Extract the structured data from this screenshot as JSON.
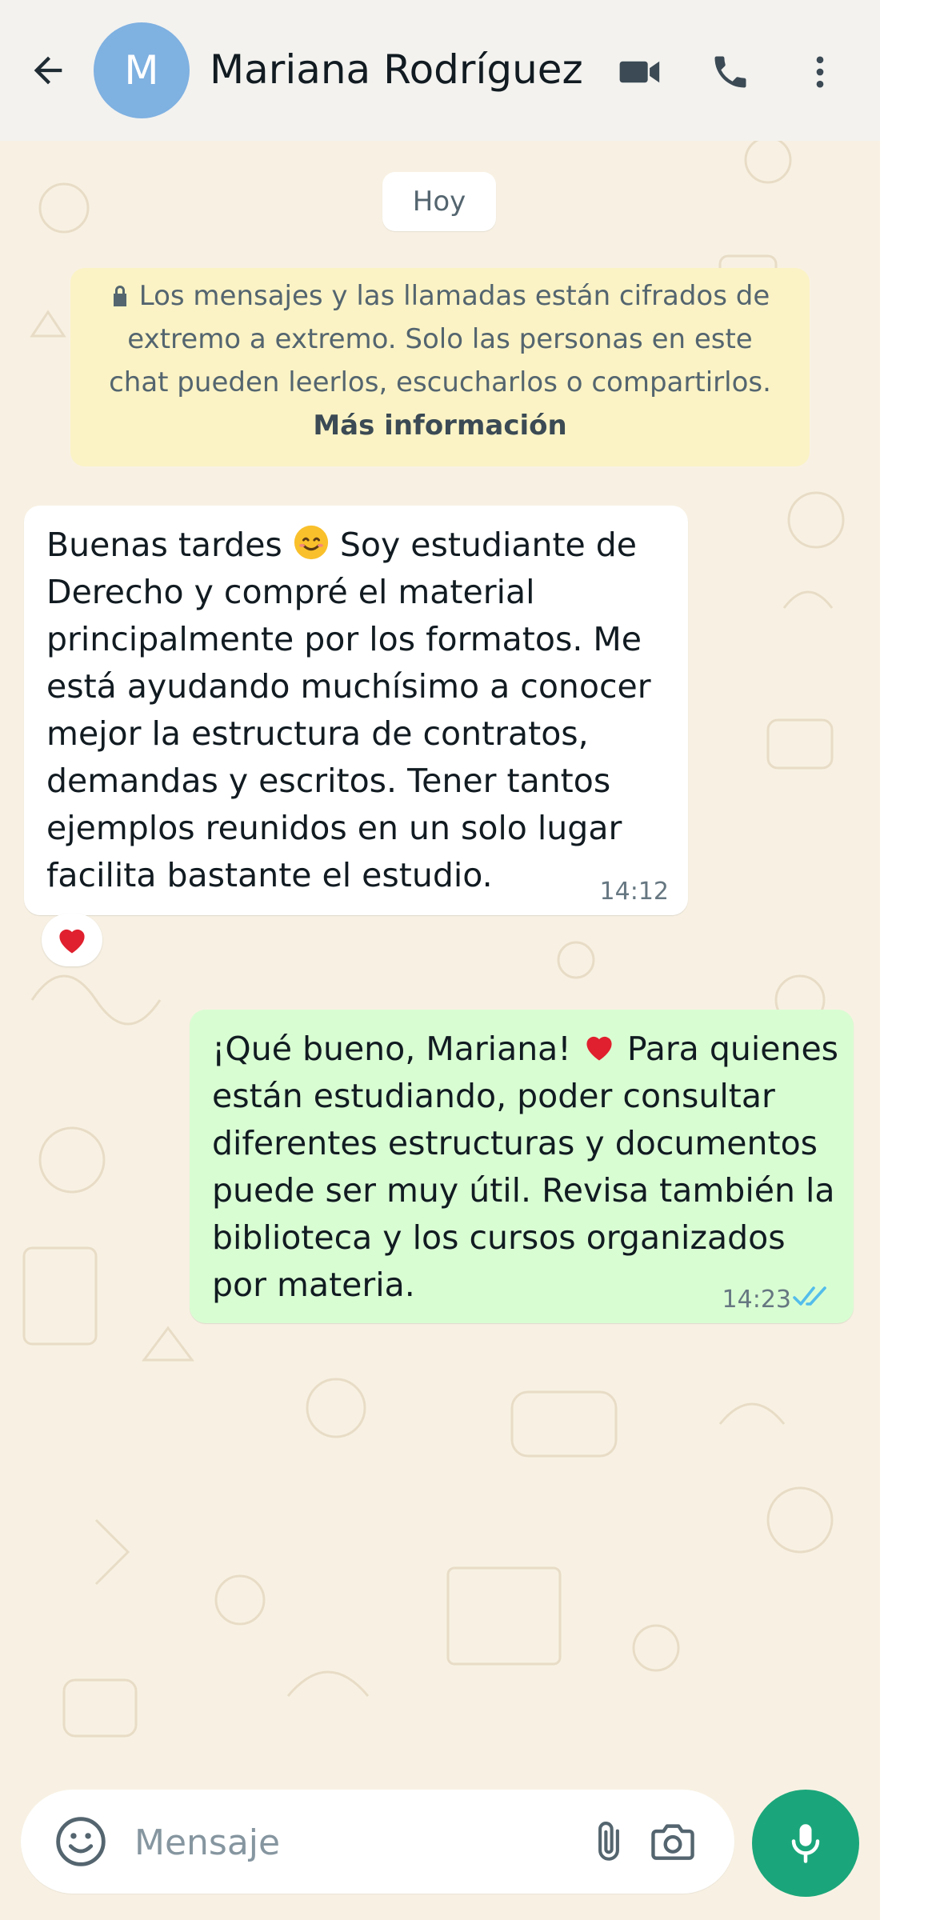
{
  "header": {
    "avatar_initial": "M",
    "contact_name": "Mariana Rodríguez",
    "icons": [
      "back-arrow-icon",
      "video-camera-icon",
      "phone-icon",
      "more-vertical-icon"
    ]
  },
  "chat": {
    "day_label": "Hoy",
    "encryption_notice": {
      "line1": "Los mensajes y las llamadas están cifrados de",
      "line2": "extremo a extremo. Solo las personas en este",
      "line3": "chat pueden leerlos, escucharlos o compartirlos.",
      "link": "Más información"
    },
    "messages": [
      {
        "direction": "incoming",
        "text_before_emoji": "Buenas tardes ",
        "emoji": "smiling-face-icon",
        "text_after_emoji": " Soy estudiante de Derecho y compré el material principalmente por los formatos. Me está ayudando muchísimo a conocer mejor la estructura de contratos, demandas y escritos. Tener tantos ejemplos reunidos en un solo lugar facilita bastante el estudio.",
        "time": "14:12",
        "reaction": "red-heart-icon"
      },
      {
        "direction": "outgoing",
        "text_before_emoji": "¡Qué bueno, Mariana! ",
        "emoji": "red-heart-icon",
        "text_after_emoji": " Para quienes están estudiando, poder consultar diferentes estructuras y documentos puede ser muy útil. Revisa también la biblioteca y los cursos organizados por materia.",
        "time": "14:23",
        "status": "read"
      }
    ]
  },
  "composer": {
    "placeholder": "Mensaje",
    "value": ""
  },
  "colors": {
    "background": "#f8f1e3",
    "header": "#f3f2ef",
    "incoming_bubble": "#ffffff",
    "outgoing_bubble": "#d9fdd3",
    "encryption_notice": "#fbf3c5",
    "mic_button": "#1aa67a",
    "avatar": "#7fb1e1",
    "read_ticks": "#53bdeb"
  }
}
